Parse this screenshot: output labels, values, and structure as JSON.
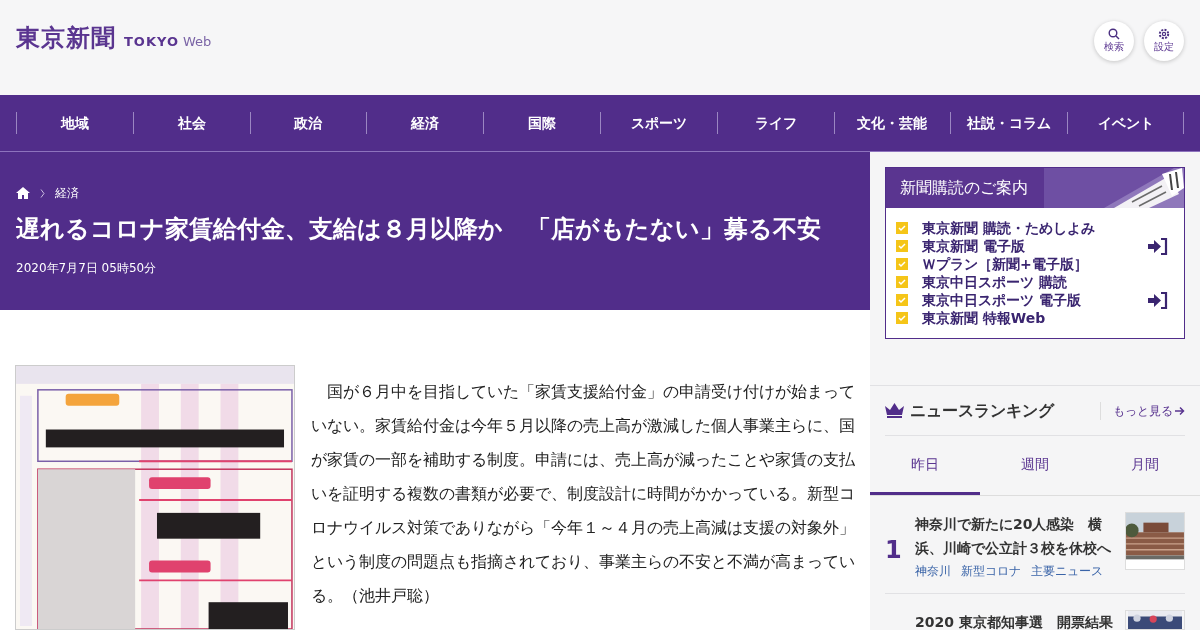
{
  "header": {
    "logo": "東京新聞",
    "logo_sub_bold": "TOKYO",
    "logo_sub_light": "Web",
    "buttons": [
      {
        "kind": "search",
        "label": "検索"
      },
      {
        "kind": "settings",
        "label": "設定"
      }
    ]
  },
  "nav": [
    "地域",
    "社会",
    "政治",
    "経済",
    "国際",
    "スポーツ",
    "ライフ",
    "文化・芸能",
    "社説・コラム",
    "イベント"
  ],
  "breadcrumb": [
    "経済"
  ],
  "article": {
    "title": "遅れるコロナ家賃給付金、支給は８月以降か　「店がもたない」募る不安",
    "date": "2020年7月7日 05時50分",
    "body": "　国が６月中を目指していた「家賃支援給付金」の申請受け付けが始まっていない。家賃給付金は今年５月以降の売上高が激減した個人事業主らに、国が家賃の一部を補助する制度。申請には、売上高が減ったことや家賃の支払いを証明する複数の書類が必要で、制度設計に時間がかかっている。新型コロナウイルス対策でありながら「今年１～４月の売上高減は支援の対象外」という制度の問題点も指摘されており、事業主らの不安と不満が高まっている。（池井戸聡）"
  },
  "subscription": {
    "title": "新聞購読のご案内",
    "items": [
      {
        "label": "東京新聞 購読・ためしよみ",
        "login_icon": false
      },
      {
        "label": "東京新聞 電子版",
        "login_icon": true
      },
      {
        "label": "Ｗプラン［新聞+電子版］",
        "login_icon": false
      },
      {
        "label": "東京中日スポーツ 購読",
        "login_icon": false
      },
      {
        "label": "東京中日スポーツ 電子版",
        "login_icon": true
      },
      {
        "label": "東京新聞 特報Web",
        "login_icon": false
      }
    ]
  },
  "ranking": {
    "title": "ニュースランキング",
    "more": "もっと見る",
    "tabs": [
      {
        "label": "昨日",
        "selected": true
      },
      {
        "label": "週間",
        "selected": false
      },
      {
        "label": "月間",
        "selected": false
      }
    ],
    "items": [
      {
        "rank": "1",
        "title": "神奈川で新たに20人感染　横浜、川崎で公立計３校を休校へ",
        "tags": [
          "神奈川",
          "新型コロナ",
          "主要ニュース"
        ]
      },
      {
        "title": "2020 東京都知事選　開票結果"
      }
    ]
  }
}
